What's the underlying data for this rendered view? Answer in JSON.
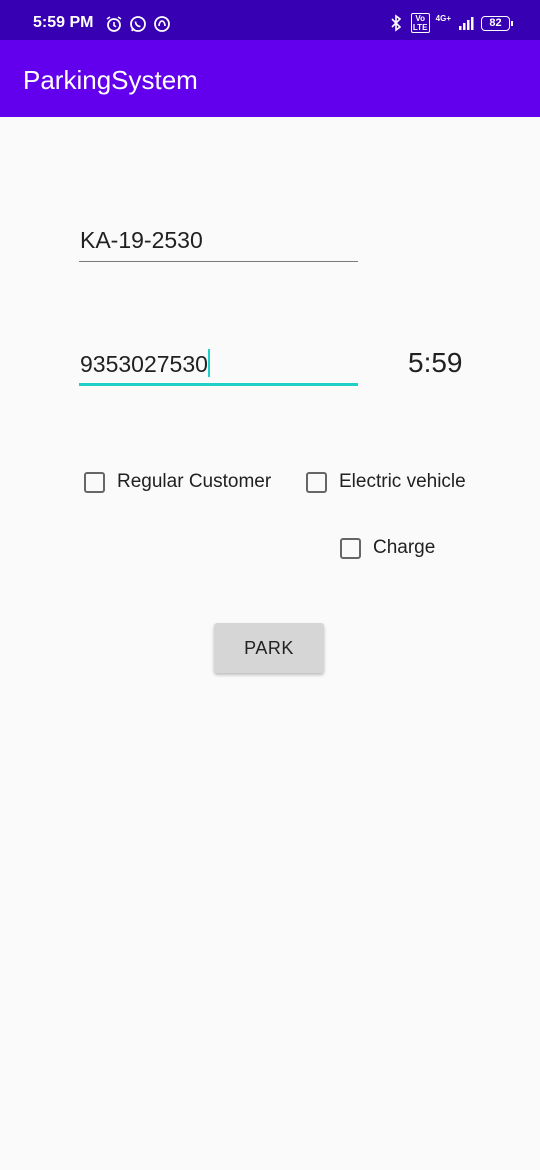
{
  "status_bar": {
    "time": "5:59 PM",
    "left_icons": [
      "alarm-icon",
      "whatsapp-icon",
      "sync-icon"
    ],
    "right_icons": [
      "bluetooth-icon",
      "volte-icon",
      "signal-icon",
      "battery-icon"
    ],
    "volte_label": "Vo LTE",
    "network_label": "4G+",
    "battery_level": "82"
  },
  "app_bar": {
    "title": "ParkingSystem"
  },
  "form": {
    "plate_value": "KA-19-2530",
    "phone_value": "9353027530",
    "clock_text": "5:59",
    "checkboxes": {
      "regular": {
        "label": "Regular Customer",
        "checked": false
      },
      "electric": {
        "label": "Electric vehicle",
        "checked": false
      },
      "charge": {
        "label": "Charge",
        "checked": false
      }
    },
    "park_label": "PARK"
  },
  "colors": {
    "status_bar": "#3700b3",
    "app_bar": "#6200ee",
    "accent": "#1fd0c8"
  }
}
